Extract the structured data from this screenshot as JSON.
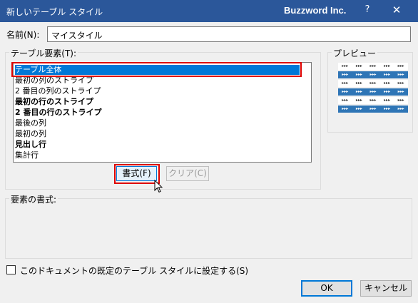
{
  "titlebar": {
    "title": "新しいテーブル スタイル",
    "brand": "Buzzword Inc.",
    "help_glyph": "?",
    "close_glyph": "✕"
  },
  "name_field": {
    "label": "名前(N):",
    "value": "マイスタイル"
  },
  "elements_group": {
    "label": "テーブル要素(T):",
    "items": [
      {
        "label": "テーブル全体",
        "bold": false,
        "selected": true
      },
      {
        "label": "最初の列のストライプ",
        "bold": false,
        "selected": false
      },
      {
        "label": "2 番目の列のストライプ",
        "bold": false,
        "selected": false
      },
      {
        "label": "最初の行のストライプ",
        "bold": true,
        "selected": false
      },
      {
        "label": "2 番目の行のストライプ",
        "bold": true,
        "selected": false
      },
      {
        "label": "最後の列",
        "bold": false,
        "selected": false
      },
      {
        "label": "最初の列",
        "bold": false,
        "selected": false
      },
      {
        "label": "見出し行",
        "bold": true,
        "selected": false
      },
      {
        "label": "集計行",
        "bold": false,
        "selected": false
      }
    ],
    "format_button": "書式(F)",
    "clear_button": "クリア(C)"
  },
  "preview_group": {
    "label": "プレビュー"
  },
  "format_group": {
    "label": "要素の書式:"
  },
  "default_checkbox": {
    "label": "このドキュメントの既定のテーブル スタイルに設定する(S)",
    "checked": false
  },
  "buttons": {
    "ok": "OK",
    "cancel": "キャンセル"
  },
  "colors": {
    "titlebar": "#2b579a",
    "selection": "#0078d7",
    "highlight": "#dd0000",
    "preview_dark": "#2e75b6"
  }
}
